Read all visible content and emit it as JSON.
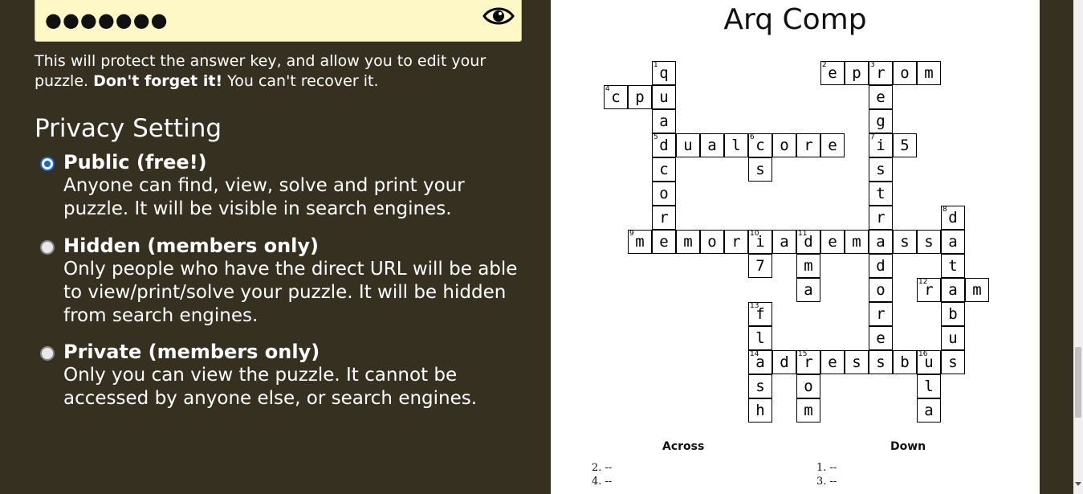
{
  "password": {
    "masked_value": "●●●●●●●",
    "icon": "eye-icon"
  },
  "hint": {
    "text_before": "This will protect the answer key, and allow you to edit your puzzle. ",
    "bold": "Don't forget it!",
    "text_after": " You can't recover it."
  },
  "privacy": {
    "title": "Privacy Setting",
    "options": [
      {
        "label": "Public (free!)",
        "desc": "Anyone can find, view, solve and print your puzzle. It will be visible in search engines.",
        "selected": true
      },
      {
        "label": "Hidden (members only)",
        "desc": "Only people who have the direct URL will be able to view/print/solve your puzzle. It will be hidden from search engines.",
        "selected": false
      },
      {
        "label": "Private (members only)",
        "desc": "Only you can view the puzzle. It cannot be accessed by anyone else, or search engines.",
        "selected": false
      }
    ]
  },
  "puzzle": {
    "title": "Arq Comp",
    "across_heading": "Across",
    "down_heading": "Down",
    "across_clues": [
      "2. --",
      "4. --"
    ],
    "down_clues": [
      "1. --",
      "3. --"
    ],
    "cells": [
      {
        "r": 0,
        "c": 2,
        "ch": "q",
        "n": "1"
      },
      {
        "r": 0,
        "c": 9,
        "ch": "e",
        "n": "2"
      },
      {
        "r": 0,
        "c": 10,
        "ch": "p"
      },
      {
        "r": 0,
        "c": 11,
        "ch": "r",
        "n": "3"
      },
      {
        "r": 0,
        "c": 12,
        "ch": "o"
      },
      {
        "r": 0,
        "c": 13,
        "ch": "m"
      },
      {
        "r": 1,
        "c": 0,
        "ch": "c",
        "n": "4"
      },
      {
        "r": 1,
        "c": 1,
        "ch": "p"
      },
      {
        "r": 1,
        "c": 2,
        "ch": "u"
      },
      {
        "r": 1,
        "c": 11,
        "ch": "e"
      },
      {
        "r": 2,
        "c": 2,
        "ch": "a"
      },
      {
        "r": 2,
        "c": 11,
        "ch": "g"
      },
      {
        "r": 3,
        "c": 2,
        "ch": "d",
        "n": "5"
      },
      {
        "r": 3,
        "c": 3,
        "ch": "u"
      },
      {
        "r": 3,
        "c": 4,
        "ch": "a"
      },
      {
        "r": 3,
        "c": 5,
        "ch": "l"
      },
      {
        "r": 3,
        "c": 6,
        "ch": "c",
        "n": "6"
      },
      {
        "r": 3,
        "c": 7,
        "ch": "o"
      },
      {
        "r": 3,
        "c": 8,
        "ch": "r"
      },
      {
        "r": 3,
        "c": 9,
        "ch": "e"
      },
      {
        "r": 3,
        "c": 11,
        "ch": "i",
        "n": "7"
      },
      {
        "r": 3,
        "c": 12,
        "ch": "5"
      },
      {
        "r": 4,
        "c": 2,
        "ch": "c"
      },
      {
        "r": 4,
        "c": 6,
        "ch": "s"
      },
      {
        "r": 4,
        "c": 11,
        "ch": "s"
      },
      {
        "r": 5,
        "c": 2,
        "ch": "o"
      },
      {
        "r": 5,
        "c": 11,
        "ch": "t"
      },
      {
        "r": 6,
        "c": 2,
        "ch": "r"
      },
      {
        "r": 6,
        "c": 11,
        "ch": "r"
      },
      {
        "r": 6,
        "c": 14,
        "ch": "d",
        "n": "8"
      },
      {
        "r": 7,
        "c": 1,
        "ch": "m",
        "n": "9"
      },
      {
        "r": 7,
        "c": 2,
        "ch": "e"
      },
      {
        "r": 7,
        "c": 3,
        "ch": "m"
      },
      {
        "r": 7,
        "c": 4,
        "ch": "o"
      },
      {
        "r": 7,
        "c": 5,
        "ch": "r"
      },
      {
        "r": 7,
        "c": 6,
        "ch": "i",
        "n": "10"
      },
      {
        "r": 7,
        "c": 7,
        "ch": "a"
      },
      {
        "r": 7,
        "c": 8,
        "ch": "d",
        "n": "11"
      },
      {
        "r": 7,
        "c": 9,
        "ch": "e"
      },
      {
        "r": 7,
        "c": 10,
        "ch": "m"
      },
      {
        "r": 7,
        "c": 11,
        "ch": "a"
      },
      {
        "r": 7,
        "c": 12,
        "ch": "s"
      },
      {
        "r": 7,
        "c": 13,
        "ch": "s"
      },
      {
        "r": 7,
        "c": 14,
        "ch": "a"
      },
      {
        "r": 8,
        "c": 6,
        "ch": "7"
      },
      {
        "r": 8,
        "c": 8,
        "ch": "m"
      },
      {
        "r": 8,
        "c": 11,
        "ch": "d"
      },
      {
        "r": 8,
        "c": 14,
        "ch": "t"
      },
      {
        "r": 9,
        "c": 8,
        "ch": "a"
      },
      {
        "r": 9,
        "c": 11,
        "ch": "o"
      },
      {
        "r": 9,
        "c": 13,
        "ch": "r",
        "n": "12"
      },
      {
        "r": 9,
        "c": 14,
        "ch": "a"
      },
      {
        "r": 9,
        "c": 15,
        "ch": "m"
      },
      {
        "r": 10,
        "c": 6,
        "ch": "f",
        "n": "13"
      },
      {
        "r": 10,
        "c": 11,
        "ch": "r"
      },
      {
        "r": 10,
        "c": 14,
        "ch": "b"
      },
      {
        "r": 11,
        "c": 6,
        "ch": "l"
      },
      {
        "r": 11,
        "c": 11,
        "ch": "e"
      },
      {
        "r": 11,
        "c": 14,
        "ch": "u"
      },
      {
        "r": 12,
        "c": 6,
        "ch": "a",
        "n": "14"
      },
      {
        "r": 12,
        "c": 7,
        "ch": "d"
      },
      {
        "r": 12,
        "c": 8,
        "ch": "r",
        "n": "15"
      },
      {
        "r": 12,
        "c": 9,
        "ch": "e"
      },
      {
        "r": 12,
        "c": 10,
        "ch": "s"
      },
      {
        "r": 12,
        "c": 11,
        "ch": "s"
      },
      {
        "r": 12,
        "c": 12,
        "ch": "b"
      },
      {
        "r": 12,
        "c": 13,
        "ch": "u",
        "n": "16"
      },
      {
        "r": 12,
        "c": 14,
        "ch": "s"
      },
      {
        "r": 13,
        "c": 6,
        "ch": "s"
      },
      {
        "r": 13,
        "c": 8,
        "ch": "o"
      },
      {
        "r": 13,
        "c": 13,
        "ch": "l"
      },
      {
        "r": 14,
        "c": 6,
        "ch": "h"
      },
      {
        "r": 14,
        "c": 8,
        "ch": "m"
      },
      {
        "r": 14,
        "c": 13,
        "ch": "a"
      }
    ]
  }
}
